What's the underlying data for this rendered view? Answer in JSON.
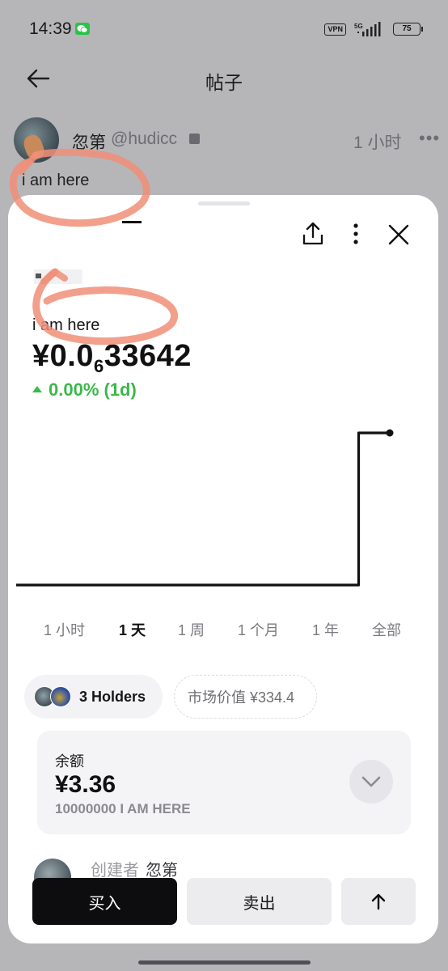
{
  "status_bar": {
    "time": "14:39",
    "vpn": "VPN",
    "network": "5G",
    "battery": "75"
  },
  "header": {
    "title": "帖子"
  },
  "post": {
    "author": "忽第",
    "handle": "@hudicc",
    "time": "1 小时",
    "more": "•••",
    "text": "i am here"
  },
  "token": {
    "name": "i am here",
    "price_prefix": "¥0.0",
    "price_subscript": "6",
    "price_suffix": "33642",
    "change": "0.00% (1d)",
    "change_color": "#3cb84a"
  },
  "chart_data": {
    "type": "line",
    "series": [
      {
        "values": [
          0.0,
          0.0,
          0.0,
          0.0,
          0.0,
          0.0,
          0.0,
          0.0,
          0.0,
          0.0,
          0.0,
          1.0,
          1.0
        ]
      }
    ],
    "x": [
      0,
      1,
      2,
      3,
      4,
      5,
      6,
      7,
      8,
      9,
      10,
      11,
      12
    ],
    "ylim": [
      0,
      1
    ],
    "grid": false,
    "line_color": "#111111"
  },
  "range_tabs": [
    "1 小时",
    "1 天",
    "1 周",
    "1 个月",
    "1 年",
    "全部"
  ],
  "active_range": "1 天",
  "holders": {
    "label": "3 Holders"
  },
  "market_cap": {
    "label": "市场价值 ¥334.4"
  },
  "balance": {
    "label": "余额",
    "value": "¥3.36",
    "amount": "10000000 I AM HERE"
  },
  "creator": {
    "label": "创建者",
    "name": "忽第"
  },
  "actions": {
    "buy": "买入",
    "sell": "卖出"
  },
  "colors": {
    "annotation": "#f08f78",
    "accent_up": "#3cb84a",
    "buy_bg": "#0d0d0f"
  }
}
